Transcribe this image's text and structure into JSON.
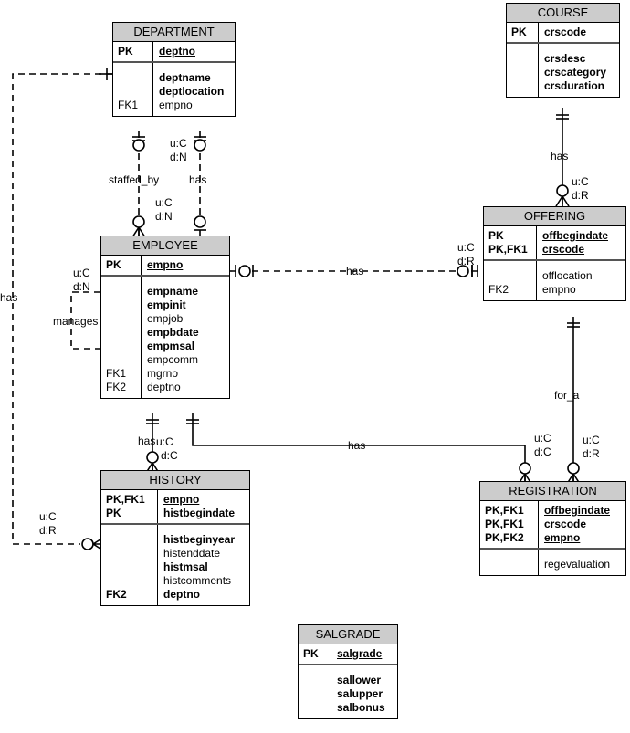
{
  "diagram": {
    "title": "ER diagram",
    "notation": "IDEF1X / crow's foot",
    "colors": {
      "header_fill": "#cccccc",
      "entity_fill": "#ffffff",
      "line": "#000000"
    }
  },
  "entities": [
    {
      "id": "department",
      "name": "DEPARTMENT",
      "keys": [
        {
          "tag": "PK",
          "attr": "deptno",
          "style": "pk"
        }
      ],
      "attrs": [
        {
          "tag": "",
          "attr": "deptname",
          "style": "bold"
        },
        {
          "tag": "",
          "attr": "deptlocation",
          "style": "bold"
        },
        {
          "tag": "FK1",
          "attr": "empno",
          "style": "normal"
        }
      ]
    },
    {
      "id": "course",
      "name": "COURSE",
      "keys": [
        {
          "tag": "PK",
          "attr": "crscode",
          "style": "pk"
        }
      ],
      "attrs": [
        {
          "tag": "",
          "attr": "crsdesc",
          "style": "bold"
        },
        {
          "tag": "",
          "attr": "crscategory",
          "style": "bold"
        },
        {
          "tag": "",
          "attr": "crsduration",
          "style": "bold"
        }
      ]
    },
    {
      "id": "employee",
      "name": "EMPLOYEE",
      "keys": [
        {
          "tag": "PK",
          "attr": "empno",
          "style": "pk"
        }
      ],
      "attrs": [
        {
          "tag": "",
          "attr": "empname",
          "style": "bold"
        },
        {
          "tag": "",
          "attr": "empinit",
          "style": "bold"
        },
        {
          "tag": "",
          "attr": "empjob",
          "style": "normal"
        },
        {
          "tag": "",
          "attr": "empbdate",
          "style": "bold"
        },
        {
          "tag": "",
          "attr": "empmsal",
          "style": "bold"
        },
        {
          "tag": "",
          "attr": "empcomm",
          "style": "normal"
        },
        {
          "tag": "FK1",
          "attr": "mgrno",
          "style": "normal"
        },
        {
          "tag": "FK2",
          "attr": "deptno",
          "style": "normal"
        }
      ]
    },
    {
      "id": "offering",
      "name": "OFFERING",
      "keys": [
        {
          "tag": "PK",
          "attr": "offbegindate",
          "style": "pk"
        },
        {
          "tag": "PK,FK1",
          "attr": "crscode",
          "style": "pk"
        }
      ],
      "attrs": [
        {
          "tag": "",
          "attr": "offlocation",
          "style": "normal"
        },
        {
          "tag": "FK2",
          "attr": "empno",
          "style": "normal"
        }
      ]
    },
    {
      "id": "history",
      "name": "HISTORY",
      "keys": [
        {
          "tag": "PK,FK1",
          "attr": "empno",
          "style": "pk"
        },
        {
          "tag": "PK",
          "attr": "histbegindate",
          "style": "pk"
        }
      ],
      "attrs": [
        {
          "tag": "",
          "attr": "histbeginyear",
          "style": "bold"
        },
        {
          "tag": "",
          "attr": "histenddate",
          "style": "normal"
        },
        {
          "tag": "",
          "attr": "histmsal",
          "style": "bold"
        },
        {
          "tag": "",
          "attr": "histcomments",
          "style": "normal"
        },
        {
          "tag": "FK2",
          "attr": "deptno",
          "style": "bold"
        }
      ]
    },
    {
      "id": "registration",
      "name": "REGISTRATION",
      "keys": [
        {
          "tag": "PK,FK1",
          "attr": "offbegindate",
          "style": "pk"
        },
        {
          "tag": "PK,FK1",
          "attr": "crscode",
          "style": "pk"
        },
        {
          "tag": "PK,FK2",
          "attr": "empno",
          "style": "pk"
        }
      ],
      "attrs": [
        {
          "tag": "",
          "attr": "regevaluation",
          "style": "normal"
        }
      ]
    },
    {
      "id": "salgrade",
      "name": "SALGRADE",
      "keys": [
        {
          "tag": "PK",
          "attr": "salgrade",
          "style": "pk"
        }
      ],
      "attrs": [
        {
          "tag": "",
          "attr": "sallower",
          "style": "bold"
        },
        {
          "tag": "",
          "attr": "salupper",
          "style": "bold"
        },
        {
          "tag": "",
          "attr": "salbonus",
          "style": "bold"
        }
      ]
    }
  ],
  "relationships": [
    {
      "id": "dept-emp-staffed-by",
      "label": "staffed_by",
      "rule_top": "",
      "rule_bottom_u": "u:C",
      "rule_bottom_d": "d:N"
    },
    {
      "id": "dept-emp-has",
      "label": "has",
      "rule_top_u": "u:C",
      "rule_top_d": "d:N"
    },
    {
      "id": "emp-manages",
      "label": "manages",
      "rule_u": "u:C",
      "rule_d": "d:N"
    },
    {
      "id": "dept-history-has",
      "label": "has",
      "rule_u": "u:C",
      "rule_d": "d:R"
    },
    {
      "id": "emp-offering-has",
      "label": "has",
      "rule_u": "u:C",
      "rule_d": "d:R"
    },
    {
      "id": "course-offering-has",
      "label": "has",
      "rule_u": "u:C",
      "rule_d": "d:R"
    },
    {
      "id": "emp-history-has",
      "label": "has",
      "rule_u": "u:C",
      "rule_d": "d:C"
    },
    {
      "id": "emp-registration-has",
      "label": "has",
      "rule_u": "u:C",
      "rule_d": "d:C"
    },
    {
      "id": "offering-registration-for-a",
      "label": "for_a",
      "rule_u": "u:C",
      "rule_d": "d:R"
    }
  ],
  "labels": {
    "staffed_by": "staffed_by",
    "has": "has",
    "manages": "manages",
    "for_a": "for_a",
    "uC": "u:C",
    "dN": "d:N",
    "dR": "d:R",
    "dC": "d:C"
  }
}
